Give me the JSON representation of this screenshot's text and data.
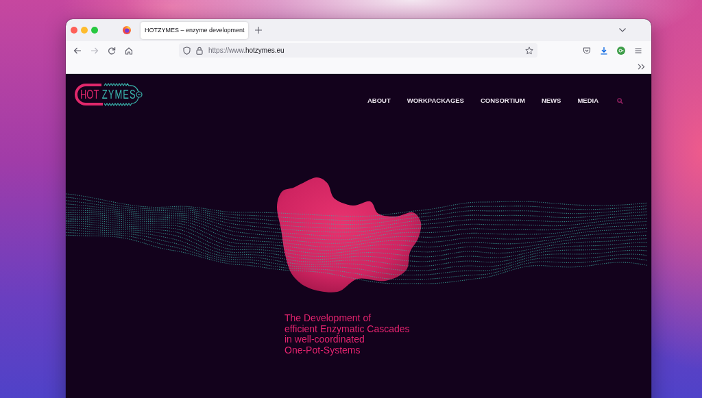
{
  "browser": {
    "tabs": [
      {
        "title": "HOTZYMES – enzyme development",
        "selected": true
      }
    ],
    "navigation": {
      "back_disabled": false,
      "forward_disabled": true
    },
    "address_bar": {
      "url_prefix": "https://www.",
      "url_domain": "hotzymes.eu"
    }
  },
  "page": {
    "logo": {
      "part_1": "HOT",
      "part_2": "ZYMES"
    },
    "nav": [
      {
        "label": "ABOUT"
      },
      {
        "label": "WORKPACKAGES"
      },
      {
        "label": "CONSORTIUM"
      },
      {
        "label": "NEWS"
      },
      {
        "label": "MEDIA"
      }
    ],
    "tagline_lines": [
      "The Development of",
      "efficient Enzymatic Cascades",
      "in well-coordinated",
      "One-Pot-Systems"
    ]
  }
}
